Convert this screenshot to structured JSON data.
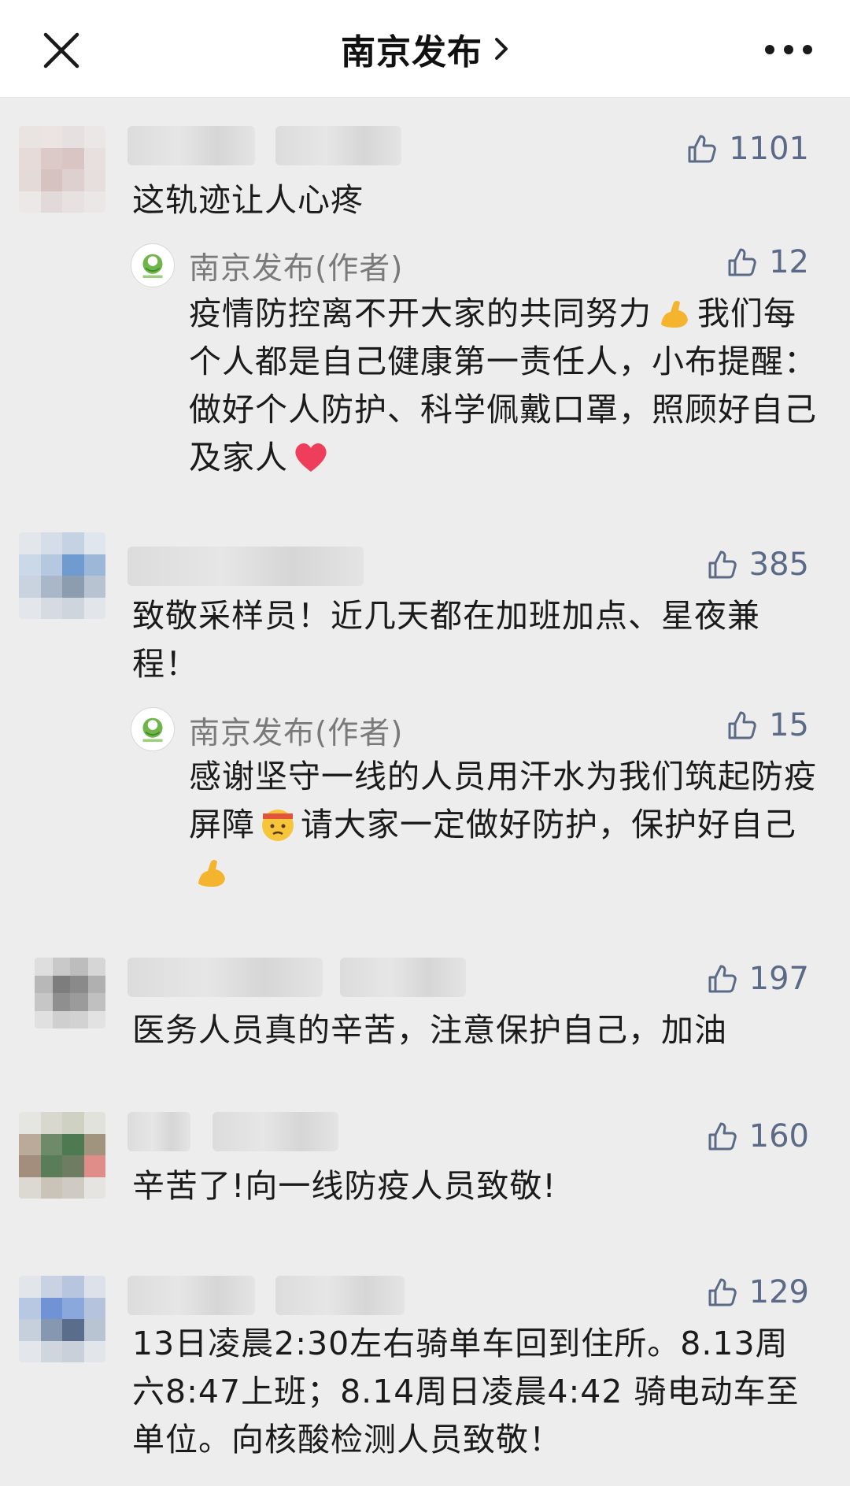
{
  "header": {
    "title": "南京发布",
    "close_icon": "close-icon",
    "chevron_icon": "chevron-right-icon",
    "more_icon": "more-icon"
  },
  "colors": {
    "like_color": "#5b6a86",
    "background": "#ededed",
    "heart": "#ef3e5c",
    "muscle": "#f5b42d"
  },
  "comments": [
    {
      "likes": "1101",
      "text": "这轨迹让人心疼",
      "reply": {
        "author": "南京发布(作者)",
        "likes": "12",
        "text_parts": [
          "疫情防控离不开大家的共同努力",
          "我们每个人都是自己健康第一责任人，小布提醒：做好个人防护、科学佩戴口罩，照顾好自己及家人",
          ""
        ],
        "emojis": [
          "flexed-biceps-emoji",
          "red-heart-emoji"
        ]
      }
    },
    {
      "likes": "385",
      "text": "致敬采样员！近几天都在加班加点、星夜兼程！",
      "reply": {
        "author": "南京发布(作者)",
        "likes": "15",
        "text_parts": [
          "感谢坚守一线的人员用汗水为我们筑起防疫屏障",
          "请大家一定做好防护，保护好自己",
          ""
        ],
        "emojis": [
          "determined-face-emoji",
          "flexed-biceps-emoji"
        ]
      }
    },
    {
      "likes": "197",
      "text": "医务人员真的辛苦，注意保护自己，加油"
    },
    {
      "likes": "160",
      "text": "辛苦了!向一线防疫人员致敬!"
    },
    {
      "likes": "129",
      "text": "13日凌晨2:30左右骑单车回到住所。8.13周六8:47上班；8.14周日凌晨4:42 骑电动车至单位。向核酸检测人员致敬！"
    }
  ]
}
